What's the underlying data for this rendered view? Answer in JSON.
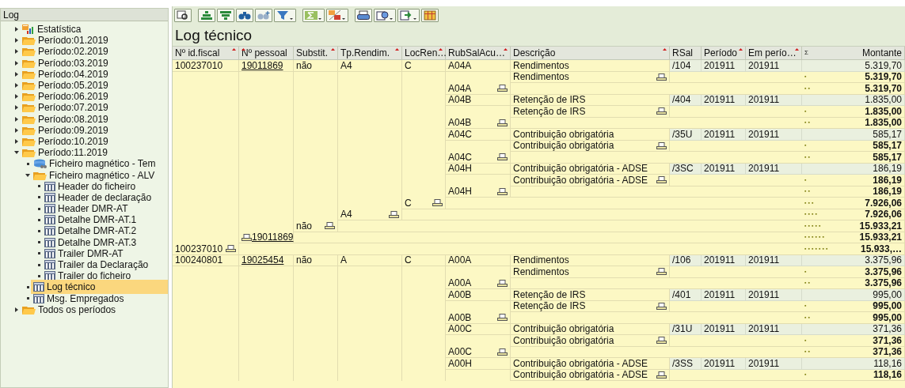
{
  "tree": {
    "title": "Log",
    "items": [
      {
        "label": "Estatística",
        "kind": "chart",
        "expanded": false,
        "selected": false
      },
      {
        "label": "Período:01.2019",
        "kind": "folder",
        "expanded": false,
        "selected": false
      },
      {
        "label": "Período:02.2019",
        "kind": "folder",
        "expanded": false,
        "selected": false
      },
      {
        "label": "Período:03.2019",
        "kind": "folder",
        "expanded": false,
        "selected": false
      },
      {
        "label": "Período:04.2019",
        "kind": "folder",
        "expanded": false,
        "selected": false
      },
      {
        "label": "Período:05.2019",
        "kind": "folder",
        "expanded": false,
        "selected": false
      },
      {
        "label": "Período:06.2019",
        "kind": "folder",
        "expanded": false,
        "selected": false
      },
      {
        "label": "Período:07.2019",
        "kind": "folder",
        "expanded": false,
        "selected": false
      },
      {
        "label": "Período:08.2019",
        "kind": "folder",
        "expanded": false,
        "selected": false
      },
      {
        "label": "Período:09.2019",
        "kind": "folder",
        "expanded": false,
        "selected": false
      },
      {
        "label": "Período:10.2019",
        "kind": "folder",
        "expanded": false,
        "selected": false
      },
      {
        "label": "Período:11.2019",
        "kind": "folder",
        "expanded": true,
        "selected": false,
        "children": [
          {
            "label": "Ficheiro magnético - Tem",
            "kind": "database",
            "selected": false
          },
          {
            "label": "Ficheiro magnético - ALV",
            "kind": "folder",
            "expanded": true,
            "selected": false,
            "children": [
              {
                "label": "Header do ficheiro",
                "kind": "table",
                "selected": false
              },
              {
                "label": "Header de declaração",
                "kind": "table",
                "selected": false
              },
              {
                "label": "Header DMR-AT",
                "kind": "table",
                "selected": false
              },
              {
                "label": "Detalhe DMR-AT.1",
                "kind": "table",
                "selected": false
              },
              {
                "label": "Detalhe DMR-AT.2",
                "kind": "table",
                "selected": false
              },
              {
                "label": "Detalhe DMR-AT.3",
                "kind": "table",
                "selected": false
              },
              {
                "label": "Trailer DMR-AT",
                "kind": "table",
                "selected": false
              },
              {
                "label": "Trailer da Declaração",
                "kind": "table",
                "selected": false
              },
              {
                "label": "Trailer do ficheiro",
                "kind": "table",
                "selected": false
              }
            ]
          },
          {
            "label": "Log técnico",
            "kind": "table",
            "selected": true
          },
          {
            "label": "Msg. Empregados",
            "kind": "table",
            "selected": false
          }
        ]
      },
      {
        "label": "Todos os períodos",
        "kind": "folder",
        "expanded": false,
        "selected": false
      }
    ]
  },
  "title": "Log técnico",
  "table": {
    "columns": [
      {
        "label": "Nº id.fiscal",
        "sorted": true
      },
      {
        "label": "Nº pessoal",
        "sorted": true
      },
      {
        "label": "Substit.",
        "sorted": true
      },
      {
        "label": "Tp.Rendim.",
        "sorted": true
      },
      {
        "label": "LocRen…",
        "sorted": true
      },
      {
        "label": "RubSalAcu…",
        "sorted": true
      },
      {
        "label": "Descrição",
        "sorted": true
      },
      {
        "label": "RSal",
        "sorted": false
      },
      {
        "label": "Período",
        "sorted": true
      },
      {
        "label": "Em perío…",
        "sorted": true
      },
      {
        "label": "Montante",
        "sorted": false,
        "sum_marker": "Σ"
      }
    ],
    "rows": [
      {
        "kind": "item",
        "cells": {
          "fiscal": "100237010",
          "pessoal": "19011869",
          "substit": "não",
          "tp": "A4",
          "loc": "C",
          "rub": "A04A",
          "desc": "Rendimentos",
          "rsal": "/104",
          "periodo": "201911",
          "em": "201911",
          "montante": "5.319,70"
        }
      },
      {
        "kind": "subtotal",
        "marker": "▪",
        "cells": {
          "desc": "Rendimentos",
          "montante": "5.319,70"
        }
      },
      {
        "kind": "subtotal",
        "marker": "▪▪",
        "cells": {
          "rub": "A04A",
          "montante": "5.319,70"
        }
      },
      {
        "kind": "item",
        "cells": {
          "rub": "A04B",
          "desc": "Retenção de IRS",
          "rsal": "/404",
          "periodo": "201911",
          "em": "201911",
          "montante": "1.835,00"
        }
      },
      {
        "kind": "subtotal",
        "marker": "▪",
        "cells": {
          "desc": "Retenção de IRS",
          "montante": "1.835,00"
        }
      },
      {
        "kind": "subtotal",
        "marker": "▪▪",
        "cells": {
          "rub": "A04B",
          "montante": "1.835,00"
        }
      },
      {
        "kind": "item",
        "cells": {
          "rub": "A04C",
          "desc": "Contribuição obrigatória",
          "rsal": "/35U",
          "periodo": "201911",
          "em": "201911",
          "montante": "585,17"
        }
      },
      {
        "kind": "subtotal",
        "marker": "▪",
        "cells": {
          "desc": "Contribuição obrigatória",
          "montante": "585,17"
        }
      },
      {
        "kind": "subtotal",
        "marker": "▪▪",
        "cells": {
          "rub": "A04C",
          "montante": "585,17"
        }
      },
      {
        "kind": "item",
        "cells": {
          "rub": "A04H",
          "desc": "Contribuição obrigatória - ADSE",
          "rsal": "/3SC",
          "periodo": "201911",
          "em": "201911",
          "montante": "186,19"
        }
      },
      {
        "kind": "subtotal",
        "marker": "▪",
        "cells": {
          "desc": "Contribuição obrigatória - ADSE",
          "montante": "186,19"
        }
      },
      {
        "kind": "subtotal",
        "marker": "▪▪",
        "cells": {
          "rub": "A04H",
          "montante": "186,19"
        }
      },
      {
        "kind": "subtotal",
        "marker": "▪▪▪",
        "cells": {
          "loc": "C",
          "montante": "7.926,06"
        }
      },
      {
        "kind": "subtotal",
        "marker": "▪▪▪▪",
        "cells": {
          "tp": "A4",
          "montante": "7.926,06"
        }
      },
      {
        "kind": "subtotal",
        "marker": "▪▪▪▪▪",
        "cells": {
          "substit": "não",
          "montante": "15.933,21"
        }
      },
      {
        "kind": "subtotal",
        "marker": "▪▪▪▪▪▪",
        "cells": {
          "pessoal": "19011869",
          "montante": "15.933,21"
        }
      },
      {
        "kind": "subtotal",
        "marker": "▪▪▪▪▪▪▪",
        "cells": {
          "fiscal": "100237010",
          "montante": "15.933,…"
        }
      },
      {
        "kind": "item",
        "cells": {
          "fiscal": "100240801",
          "pessoal": "19025454",
          "substit": "não",
          "tp": "A",
          "loc": "C",
          "rub": "A00A",
          "desc": "Rendimentos",
          "rsal": "/106",
          "periodo": "201911",
          "em": "201911",
          "montante": "3.375,96"
        }
      },
      {
        "kind": "subtotal",
        "marker": "▪",
        "cells": {
          "desc": "Rendimentos",
          "montante": "3.375,96"
        }
      },
      {
        "kind": "subtotal",
        "marker": "▪▪",
        "cells": {
          "rub": "A00A",
          "montante": "3.375,96"
        }
      },
      {
        "kind": "item",
        "cells": {
          "rub": "A00B",
          "desc": "Retenção de IRS",
          "rsal": "/401",
          "periodo": "201911",
          "em": "201911",
          "montante": "995,00"
        }
      },
      {
        "kind": "subtotal",
        "marker": "▪",
        "cells": {
          "desc": "Retenção de IRS",
          "montante": "995,00"
        }
      },
      {
        "kind": "subtotal",
        "marker": "▪▪",
        "cells": {
          "rub": "A00B",
          "montante": "995,00"
        }
      },
      {
        "kind": "item",
        "cells": {
          "rub": "A00C",
          "desc": "Contribuição obrigatória",
          "rsal": "/31U",
          "periodo": "201911",
          "em": "201911",
          "montante": "371,36"
        }
      },
      {
        "kind": "subtotal",
        "marker": "▪",
        "cells": {
          "desc": "Contribuição obrigatória",
          "montante": "371,36"
        }
      },
      {
        "kind": "subtotal",
        "marker": "▪▪",
        "cells": {
          "rub": "A00C",
          "montante": "371,36"
        }
      },
      {
        "kind": "item",
        "cells": {
          "rub": "A00H",
          "desc": "Contribuição obrigatória - ADSE",
          "rsal": "/3SS",
          "periodo": "201911",
          "em": "201911",
          "montante": "118,16"
        }
      },
      {
        "kind": "subtotal",
        "marker": "▪",
        "cells": {
          "desc": "Contribuição obrigatória - ADSE",
          "montante": "118,16"
        }
      }
    ]
  }
}
